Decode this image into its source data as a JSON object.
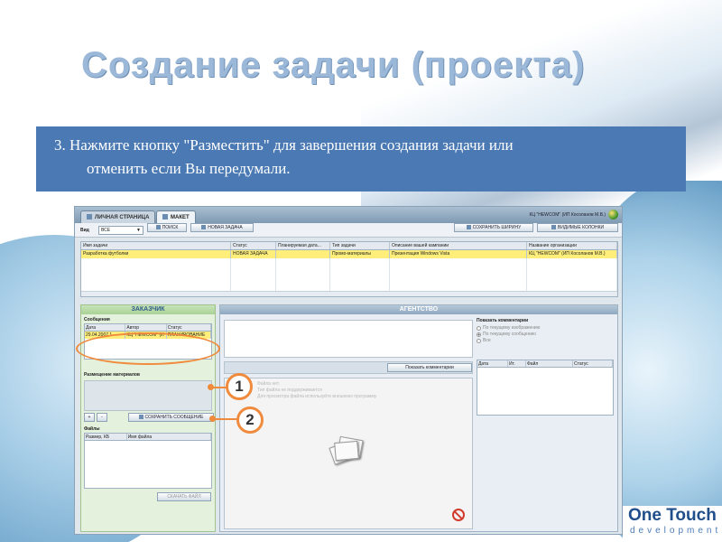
{
  "slide": {
    "title": "Создание задачи (проекта)",
    "instruction_line1": "3. Нажмите кнопку \"Разместить\" для завершения создания задачи или",
    "instruction_line2": "отменить если Вы передумали."
  },
  "app": {
    "tabs": [
      {
        "label": "ЛИЧНАЯ СТРАНИЦА"
      },
      {
        "label": "МАКЕТ"
      }
    ],
    "org_name": "КЦ \"НЕWСОМ\" (ИП Косоланов М.В.)",
    "toolbar": {
      "view_label": "Вид",
      "view_value": "ВСЕ",
      "search_label": "ПОИСК",
      "new_task_label": "НОВАЯ ЗАДАЧА",
      "save_width_label": "СОХРАНИТЬ ШИРИНУ",
      "visible_columns_label": "ВИДИМЫЕ КОЛОНКИ"
    },
    "grid": {
      "columns": [
        "Имя задачи",
        "Статус",
        "Планируемая дата...",
        "Тип задачи",
        "Описание вашей кампании",
        "Название организации"
      ],
      "rows": [
        [
          "Разработка футболки",
          "НОВАЯ ЗАДАЧА",
          "",
          "Промо-материалы",
          "Презентация Windows Vista",
          "КЦ \"НЕWСОМ\" (ИП Косоланов М.В.)"
        ]
      ]
    },
    "customer": {
      "title": "ЗАКАЗЧИК",
      "messages_label": "Сообщения",
      "messages_columns": [
        "Дата",
        "Автор",
        "Статус"
      ],
      "messages_rows": [
        [
          "29.04.2007 1",
          "КЦ \"НЕWСОМ\" (И",
          "ПЛАНИРОВАНИЕ"
        ]
      ],
      "placement_label": "Размещение материалов",
      "save_message_label": "СОХРАНИТЬ СООБЩЕНИЕ",
      "files_label": "Файлы",
      "files_columns": [
        "Размер, КБ",
        "Имя файла"
      ],
      "download_label": "СКАЧАТЬ ФАЙЛ"
    },
    "agency": {
      "title": "АГЕНТСТВО",
      "show_comments_button": "Показать комментарии",
      "comments_title": "Показать комментарии",
      "radio_options": [
        "По текущему изображению",
        "По текущему сообщению",
        "Все"
      ],
      "comments_columns": [
        "Дата",
        "Ит.",
        "Файл",
        "Статус"
      ],
      "ghost_lines": [
        "Файла нет.",
        "Тип файла не поддерживается",
        "Для просмотра файла используйте внешнюю программу"
      ]
    }
  },
  "callouts": [
    "1",
    "2"
  ],
  "logo": {
    "name": "One Touch",
    "sub": "development"
  },
  "colors": {
    "instruction_bg": "#4a79b3",
    "callout": "#f08a3c",
    "title": "#9bb8d8",
    "highlight_row": "#ffef7a"
  }
}
